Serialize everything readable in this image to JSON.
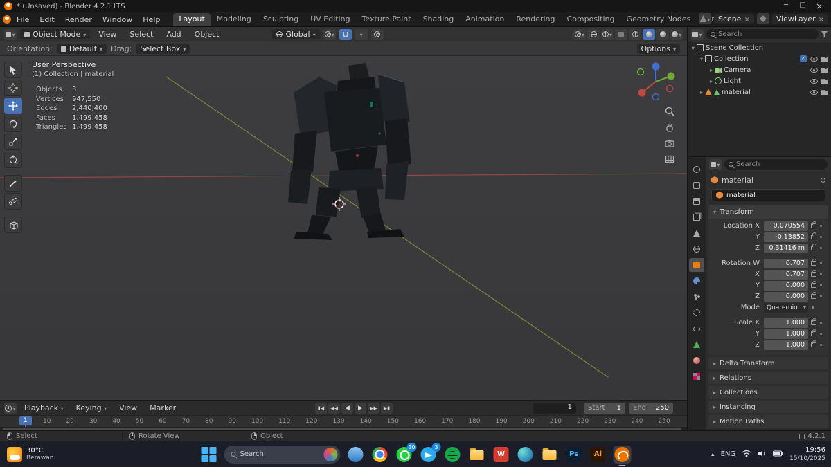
{
  "window": {
    "title": "* (Unsaved) - Blender 4.2.1 LTS"
  },
  "menubar": {
    "menus": [
      {
        "label": "File"
      },
      {
        "label": "Edit"
      },
      {
        "label": "Render"
      },
      {
        "label": "Window"
      },
      {
        "label": "Help"
      }
    ],
    "workspaces": [
      {
        "label": "Layout"
      },
      {
        "label": "Modeling"
      },
      {
        "label": "Sculpting"
      },
      {
        "label": "UV Editing"
      },
      {
        "label": "Texture Paint"
      },
      {
        "label": "Shading"
      },
      {
        "label": "Animation"
      },
      {
        "label": "Rendering"
      },
      {
        "label": "Compositing"
      },
      {
        "label": "Geometry Nodes"
      },
      {
        "label": "Scripting"
      },
      {
        "label": "+"
      }
    ],
    "scene_label": "Scene",
    "viewlayer_label": "ViewLayer"
  },
  "viewport_header": {
    "mode": "Object Mode",
    "menus": [
      {
        "label": "View"
      },
      {
        "label": "Select"
      },
      {
        "label": "Add"
      },
      {
        "label": "Object"
      }
    ],
    "orientation": "Global"
  },
  "tool_options": {
    "orientation_label": "Orientation:",
    "orientation_value": "Default",
    "drag_label": "Drag:",
    "drag_value": "Select Box",
    "options_label": "Options"
  },
  "viewport": {
    "view_name": "User Perspective",
    "context_path": "(1) Collection | material",
    "stats": [
      {
        "label": "Objects",
        "value": "3"
      },
      {
        "label": "Vertices",
        "value": "947,550"
      },
      {
        "label": "Edges",
        "value": "2,440,400"
      },
      {
        "label": "Faces",
        "value": "1,499,458"
      },
      {
        "label": "Triangles",
        "value": "1,499,458"
      }
    ]
  },
  "outliner": {
    "search_placeholder": "Search",
    "rows": [
      {
        "label": "Scene Collection"
      },
      {
        "label": "Collection"
      },
      {
        "label": "Camera"
      },
      {
        "label": "Light"
      },
      {
        "label": "material"
      }
    ]
  },
  "properties": {
    "search_placeholder": "Search",
    "breadcrumb_object": "material",
    "id_field": "material",
    "transform_title": "Transform",
    "transform_rows": [
      {
        "label": "Location X",
        "value": "0.070554"
      },
      {
        "label": "Y",
        "value": "-0.13852"
      },
      {
        "label": "Z",
        "value": "0.31416 m"
      },
      {
        "label": "Rotation W",
        "value": "0.707"
      },
      {
        "label": "X",
        "value": "0.707"
      },
      {
        "label": "Y",
        "value": "0.000"
      },
      {
        "label": "Z",
        "value": "0.000"
      },
      {
        "label": "Mode",
        "value": "Quaternio..."
      },
      {
        "label": "Scale X",
        "value": "1.000"
      },
      {
        "label": "Y",
        "value": "1.000"
      },
      {
        "label": "Z",
        "value": "1.000"
      }
    ],
    "sections": [
      {
        "label": "Delta Transform"
      },
      {
        "label": "Relations"
      },
      {
        "label": "Collections"
      },
      {
        "label": "Instancing"
      },
      {
        "label": "Motion Paths"
      }
    ]
  },
  "timeline": {
    "menus": [
      {
        "label": "Playback"
      },
      {
        "label": "Keying"
      },
      {
        "label": "View"
      },
      {
        "label": "Marker"
      }
    ],
    "current_frame": "1",
    "start_label": "Start",
    "start_value": "1",
    "end_label": "End",
    "end_value": "250",
    "ruler_labels": [
      "10",
      "20",
      "30",
      "40",
      "50",
      "60",
      "70",
      "80",
      "90",
      "100",
      "110",
      "120",
      "130",
      "140",
      "150",
      "160",
      "170",
      "180",
      "190",
      "200",
      "210",
      "220",
      "230",
      "240",
      "250"
    ]
  },
  "statusbar": {
    "hints": [
      {
        "label": "Select"
      },
      {
        "label": "Rotate View"
      },
      {
        "label": "Object"
      }
    ],
    "version": "4.2.1"
  },
  "taskbar": {
    "weather_temp": "30°C",
    "weather_desc": "Berawan",
    "search_placeholder": "Search",
    "apps": [
      {
        "name": "file-explorer",
        "glyph": ""
      },
      {
        "name": "chrome",
        "glyph": ""
      },
      {
        "name": "whatsapp",
        "glyph": "",
        "badge": "20"
      },
      {
        "name": "telegram",
        "glyph": "",
        "badge": "3"
      },
      {
        "name": "spotify",
        "glyph": ""
      },
      {
        "name": "folder",
        "glyph": ""
      },
      {
        "name": "wps-office",
        "glyph": "W"
      },
      {
        "name": "edge",
        "glyph": ""
      },
      {
        "name": "media-folder",
        "glyph": ""
      },
      {
        "name": "photoshop",
        "glyph": "Ps"
      },
      {
        "name": "illustrator",
        "glyph": "Ai"
      },
      {
        "name": "blender",
        "glyph": ""
      }
    ],
    "tray_lang": "ENG",
    "time": "19:56",
    "date": "15/10/2025"
  }
}
